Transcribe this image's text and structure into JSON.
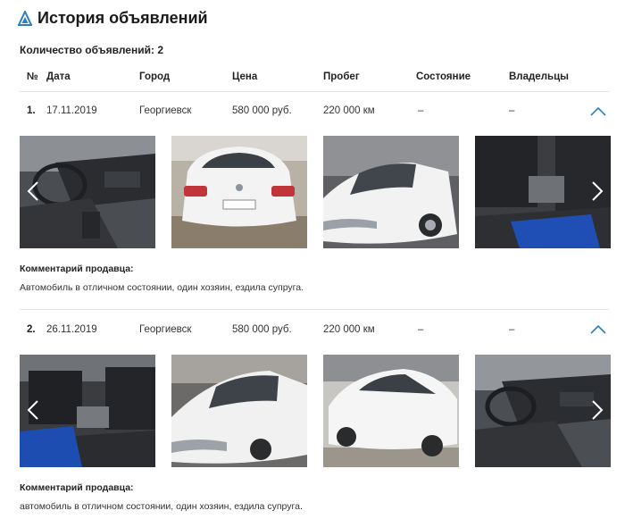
{
  "page": {
    "title": "История объявлений",
    "count_label": "Количество объявлений:",
    "count_value": "2"
  },
  "table": {
    "headers": {
      "num": "№",
      "date": "Дата",
      "city": "Город",
      "price": "Цена",
      "mileage": "Пробег",
      "condition": "Состояние",
      "owners": "Владельцы"
    }
  },
  "listings": [
    {
      "num": "1.",
      "date": "17.11.2019",
      "city": "Георгиевск",
      "price": "580 000 руб.",
      "mileage": "220 000 км",
      "condition": "–",
      "owners": "–",
      "comment_label": "Комментарий продавца:",
      "comment": "Автомобиль в отличном состоянии, один хозяин, ездила супруга."
    },
    {
      "num": "2.",
      "date": "26.11.2019",
      "city": "Георгиевск",
      "price": "580 000 руб.",
      "mileage": "220 000 км",
      "condition": "–",
      "owners": "–",
      "comment_label": "Комментарий продавца:",
      "comment": "автомобиль в отличном состоянии, один хозяин, ездила супруга."
    }
  ],
  "colors": {
    "accent": "#2b7dc4",
    "divider": "#e4e4e4"
  },
  "icons": {
    "logo": "triangle-logo-icon",
    "collapse": "chevron-up-icon",
    "prev": "chevron-left-icon",
    "next": "chevron-right-icon"
  }
}
